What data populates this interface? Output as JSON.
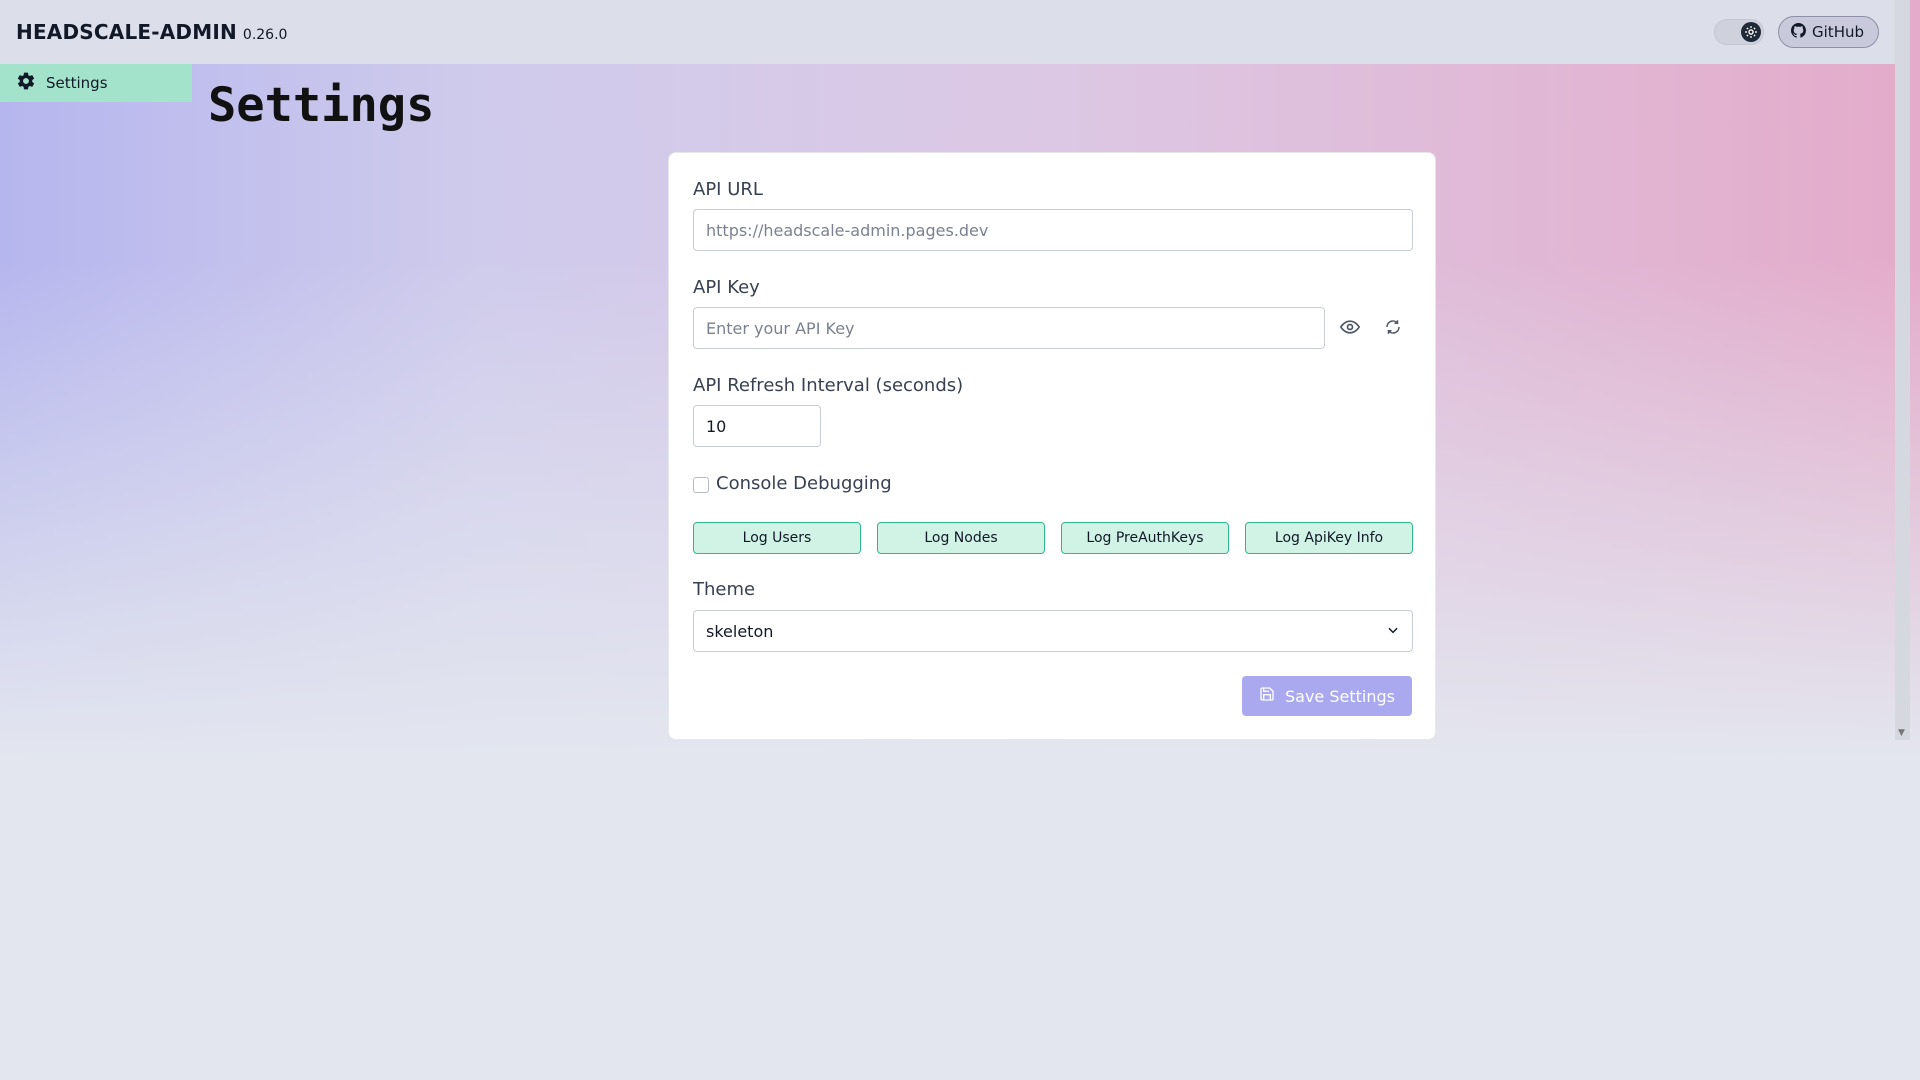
{
  "header": {
    "app_title": "HEADSCALE-ADMIN",
    "version": "0.26.0",
    "github_label": "GitHub"
  },
  "sidebar": {
    "items": [
      {
        "label": "Settings",
        "icon": "gear-icon",
        "active": true
      }
    ]
  },
  "page": {
    "title": "Settings"
  },
  "form": {
    "api_url": {
      "label": "API URL",
      "value": "",
      "placeholder": "https://headscale-admin.pages.dev"
    },
    "api_key": {
      "label": "API Key",
      "value": "",
      "placeholder": "Enter your API Key"
    },
    "refresh_interval": {
      "label": "API Refresh Interval (seconds)",
      "value": "10"
    },
    "console_debugging": {
      "label": "Console Debugging",
      "checked": false
    },
    "log_buttons": {
      "users": "Log Users",
      "nodes": "Log Nodes",
      "preauthkeys": "Log PreAuthKeys",
      "apikey_info": "Log ApiKey Info"
    },
    "theme": {
      "label": "Theme",
      "selected": "skeleton"
    },
    "save_label": "Save Settings"
  },
  "colors": {
    "accent": "#aaa9ef",
    "sidebar_active": "#a3e3cc",
    "log_button_bg": "#d1f3e6",
    "log_button_border": "#2fb88b"
  }
}
